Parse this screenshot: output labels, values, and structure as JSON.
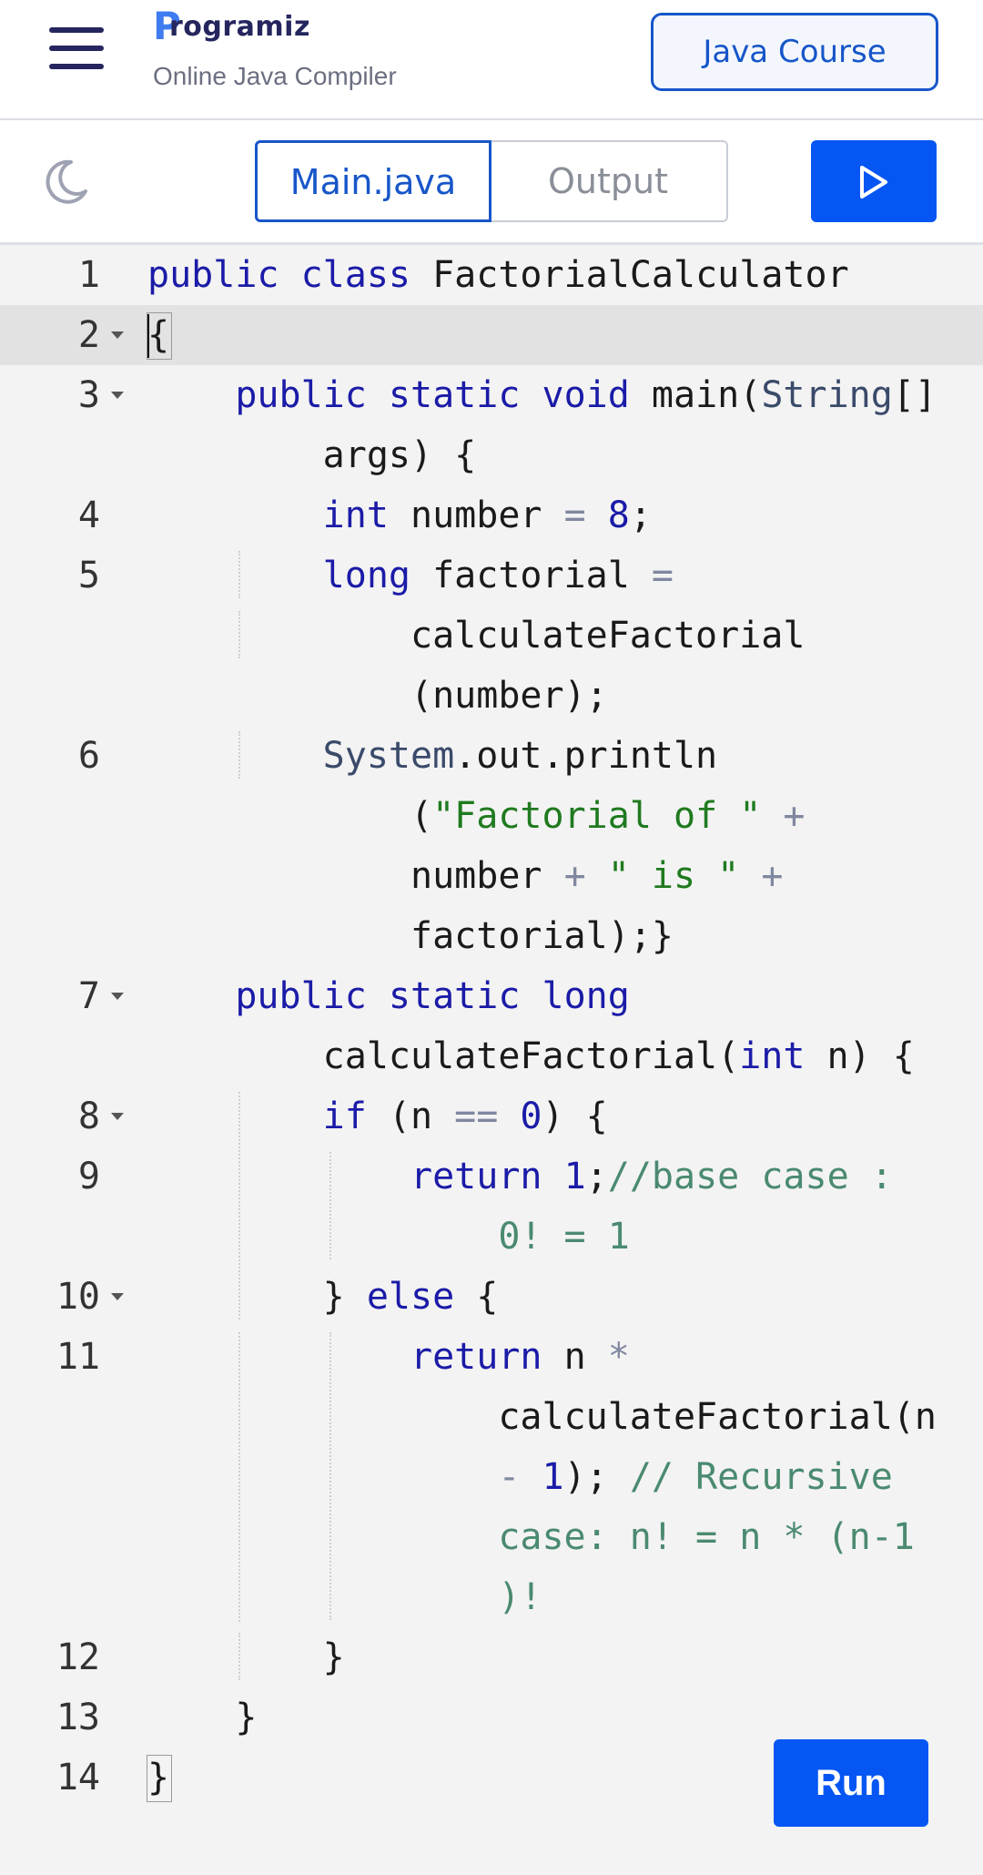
{
  "header": {
    "logo_mark": "P",
    "logo_text": "rogramiz",
    "subtitle": "Online Java Compiler",
    "course_button": "Java Course"
  },
  "toolbar": {
    "tabs": [
      {
        "label": "Main.java",
        "active": true
      },
      {
        "label": "Output",
        "active": false
      }
    ],
    "play_icon": "play-icon",
    "theme_icon": "moon-icon"
  },
  "editor": {
    "language": "java",
    "lines": [
      {
        "num": "1",
        "fold": false,
        "text": "public class FactorialCalculator"
      },
      {
        "num": "2",
        "fold": true,
        "text": "{"
      },
      {
        "num": "3",
        "fold": true,
        "text": "    public static void main(String[] args) {"
      },
      {
        "num": "4",
        "fold": false,
        "text": "        int number = 8;"
      },
      {
        "num": "5",
        "fold": false,
        "text": "        long factorial = calculateFactorial(number);"
      },
      {
        "num": "6",
        "fold": false,
        "text": "        System.out.println(\"Factorial of \" + number + \" is \" + factorial);}"
      },
      {
        "num": "7",
        "fold": true,
        "text": "    public static long calculateFactorial(int n) {"
      },
      {
        "num": "8",
        "fold": true,
        "text": "        if (n == 0) {"
      },
      {
        "num": "9",
        "fold": false,
        "text": "            return 1;//base case : 0! = 1"
      },
      {
        "num": "10",
        "fold": true,
        "text": "        } else {"
      },
      {
        "num": "11",
        "fold": false,
        "text": "            return n * calculateFactorial(n - 1); // Recursive case: n! = n * (n-1)!"
      },
      {
        "num": "12",
        "fold": false,
        "text": "        }"
      },
      {
        "num": "13",
        "fold": false,
        "text": "    }"
      },
      {
        "num": "14",
        "fold": false,
        "text": "}"
      }
    ]
  },
  "run_button": "Run",
  "colors": {
    "accent": "#0556f3",
    "brand_dark": "#25265e",
    "keyword": "#1b1ba8",
    "string": "#1f7a1f",
    "comment": "#4a8a70"
  }
}
